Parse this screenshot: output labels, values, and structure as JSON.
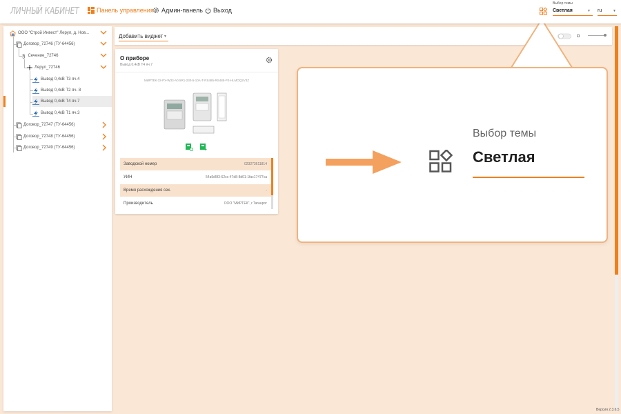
{
  "app": {
    "title": "ЛИЧНЫЙ КАБИНЕТ",
    "version": "Версия 2.3.6.5"
  },
  "nav": [
    {
      "label": "Панель управления",
      "icon": "dashboard-icon",
      "active": true
    },
    {
      "label": "Админ-панель",
      "icon": "gear-icon",
      "active": false
    },
    {
      "label": "Выход",
      "icon": "power-icon",
      "active": false
    }
  ],
  "theme": {
    "label": "Выбор темы",
    "value": "Светлая"
  },
  "language": {
    "value": "ru"
  },
  "sidebar": {
    "items": [
      {
        "label": "ООО \"Строй Инвест\" Лерул, д. Нов...",
        "icon": "organization-icon",
        "expanded": true
      },
      {
        "label": "Договор_72746 (ТУ-64456)",
        "icon": "contract-icon",
        "expanded": true
      },
      {
        "label": "Сечение_72746",
        "icon": "section-icon",
        "expanded": true
      },
      {
        "label": "Лерул_72746",
        "icon": "node-icon",
        "expanded": true
      },
      {
        "label": "Вывод 0,4кВ Т3 яч.4",
        "icon": "meter-icon"
      },
      {
        "label": "Вывод 0,4кВ Т2 яч. 8",
        "icon": "meter-icon"
      },
      {
        "label": "Вывод 0,4кВ Т4 яч.7",
        "icon": "meter-icon",
        "selected": true
      },
      {
        "label": "Вывод 0,4кВ Т1 яч.3",
        "icon": "meter-icon"
      },
      {
        "label": "Договор_72747 (ТУ-64456)",
        "icon": "contract-icon",
        "expanded": false
      },
      {
        "label": "Договор_72748 (ТУ-64456)",
        "icon": "contract-icon",
        "expanded": false
      },
      {
        "label": "Договор_72749 (ТУ-64456)",
        "icon": "contract-icon",
        "expanded": false
      }
    ]
  },
  "widgets": {
    "add_label": "Добавить виджет"
  },
  "device_card": {
    "title": "О приборе",
    "subtitle": "Вывод 0,4кВ Т4 яч.7",
    "model": "МИРТЕК-32-РУ-W33-A0.5R1-230-5-10А-T-RS485-RS485-P2-HLMOQ2V3Z",
    "properties": [
      {
        "key": "Заводской номер",
        "value": "023273611814"
      },
      {
        "key": "УИН",
        "value": "54a9d5f3-62cc-47d8-8d01-1fac17477ca"
      },
      {
        "key": "Время расхождения сек.",
        "value": "-"
      },
      {
        "key": "Производитель",
        "value": "ООО \"МИРТЕК\", г.Таганрог"
      }
    ]
  },
  "colors": {
    "accent": "#f07f1e",
    "background": "#fbe7d6",
    "row_alt": "#f9e2cd"
  }
}
